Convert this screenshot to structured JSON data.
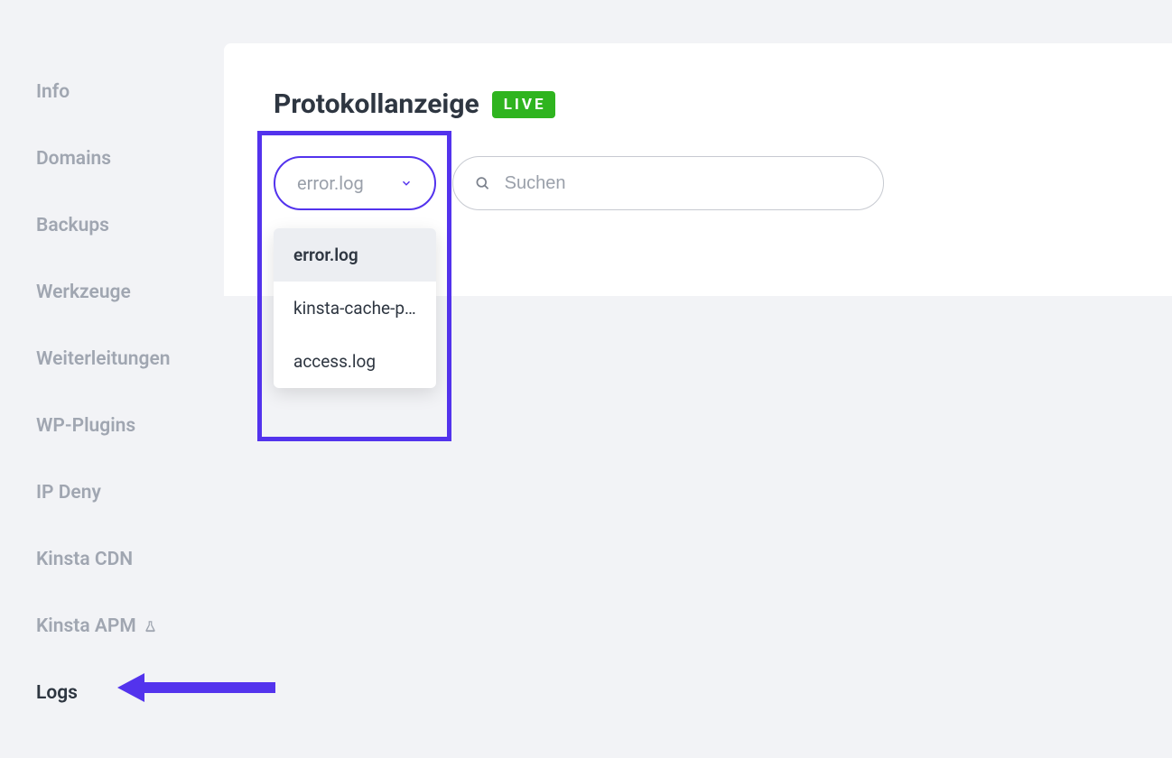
{
  "sidebar": {
    "items": [
      {
        "label": "Info"
      },
      {
        "label": "Domains"
      },
      {
        "label": "Backups"
      },
      {
        "label": "Werkzeuge"
      },
      {
        "label": "Weiterleitungen"
      },
      {
        "label": "WP-Plugins"
      },
      {
        "label": "IP Deny"
      },
      {
        "label": "Kinsta CDN"
      },
      {
        "label": "Kinsta APM"
      },
      {
        "label": "Logs"
      }
    ]
  },
  "header": {
    "title": "Protokollanzeige",
    "badge": "LIVE"
  },
  "logSelect": {
    "value": "error.log",
    "options": [
      "error.log",
      "kinsta-cache-p…",
      "access.log"
    ]
  },
  "search": {
    "placeholder": "Suchen"
  },
  "colors": {
    "accent": "#5333ed",
    "badge": "#2fb41f"
  }
}
